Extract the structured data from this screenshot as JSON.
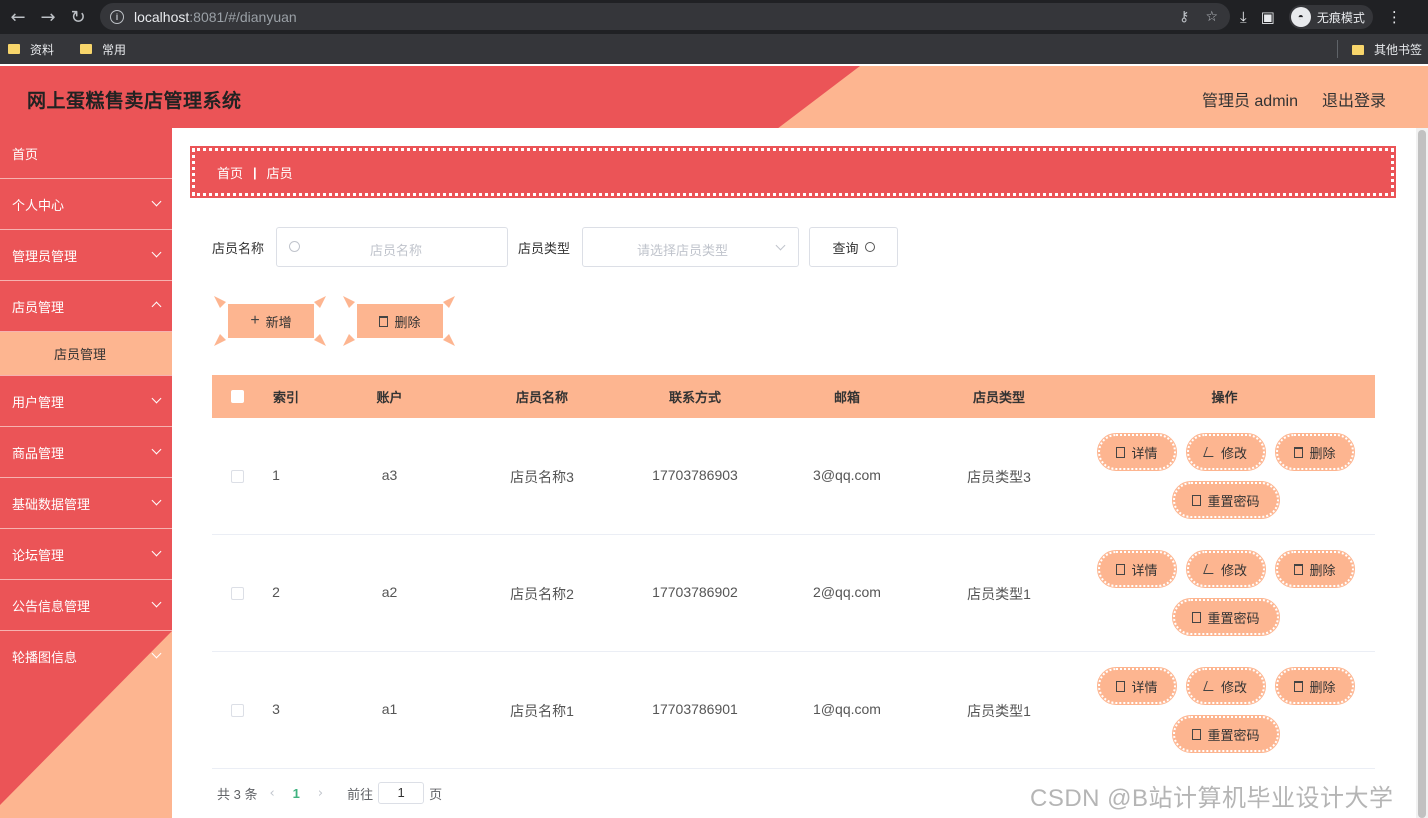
{
  "browser": {
    "url_host": "localhost",
    "url_rest": ":8081/#/dianyuan",
    "incognito_label": "无痕模式",
    "bookmarks": [
      "资料",
      "常用"
    ],
    "other_bookmarks": "其他书签"
  },
  "header": {
    "title": "网上蛋糕售卖店管理系统",
    "admin_label": "管理员 admin",
    "logout_label": "退出登录"
  },
  "sidebar": {
    "items": [
      {
        "label": "首页"
      },
      {
        "label": "个人中心"
      },
      {
        "label": "管理员管理"
      },
      {
        "label": "店员管理"
      },
      {
        "label": "店员管理"
      },
      {
        "label": "用户管理"
      },
      {
        "label": "商品管理"
      },
      {
        "label": "基础数据管理"
      },
      {
        "label": "论坛管理"
      },
      {
        "label": "公告信息管理"
      },
      {
        "label": "轮播图信息"
      }
    ]
  },
  "breadcrumb": {
    "home": "首页",
    "current": "店员"
  },
  "search": {
    "name_label": "店员名称",
    "name_placeholder": "店员名称",
    "type_label": "店员类型",
    "type_placeholder": "请选择店员类型",
    "query_label": "查询"
  },
  "actions": {
    "add_label": "新增",
    "delete_label": "删除"
  },
  "table": {
    "columns": [
      "索引",
      "账户",
      "店员名称",
      "联系方式",
      "邮箱",
      "店员类型",
      "操作"
    ],
    "rows": [
      {
        "index": "1",
        "account": "a3",
        "name": "店员名称3",
        "phone": "17703786903",
        "email": "3@qq.com",
        "type": "店员类型3"
      },
      {
        "index": "2",
        "account": "a2",
        "name": "店员名称2",
        "phone": "17703786902",
        "email": "2@qq.com",
        "type": "店员类型1"
      },
      {
        "index": "3",
        "account": "a1",
        "name": "店员名称1",
        "phone": "17703786901",
        "email": "1@qq.com",
        "type": "店员类型1"
      }
    ],
    "ops": {
      "detail": "详情",
      "edit": "修改",
      "delete": "删除",
      "reset": "重置密码"
    }
  },
  "pagination": {
    "total": "共 3 条",
    "current": "1",
    "goto_prefix": "前往",
    "goto_value": "1",
    "goto_suffix": "页"
  },
  "watermark": "CSDN @B站计算机毕业设计大学",
  "colors": {
    "primary_red": "#eb5457",
    "peach": "#fdb590"
  }
}
